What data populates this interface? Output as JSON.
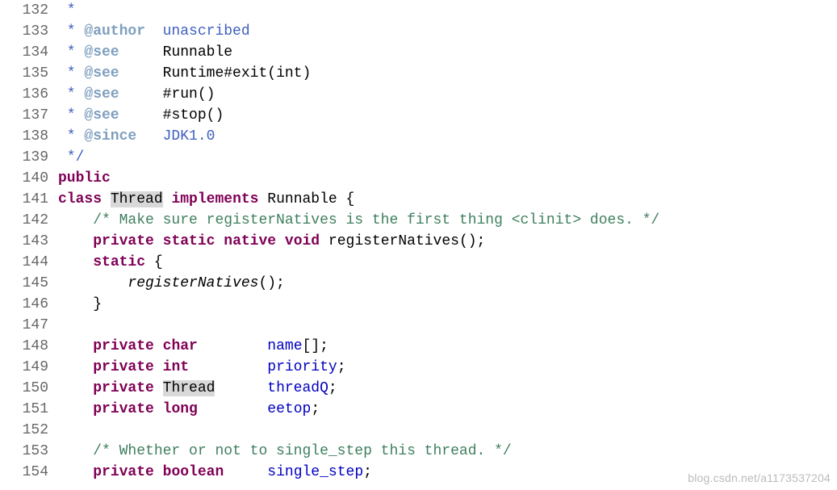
{
  "gutter": {
    "start": 132,
    "end": 154
  },
  "lines": {
    "132": {
      "segments": [
        {
          "cls": "jdoc-comment",
          "text": " *"
        }
      ]
    },
    "133": {
      "segments": [
        {
          "cls": "jdoc-comment",
          "text": " * "
        },
        {
          "cls": "jdoc-tag",
          "text": "@author"
        },
        {
          "cls": "jdoc-comment",
          "text": "  unascribed"
        }
      ]
    },
    "134": {
      "segments": [
        {
          "cls": "jdoc-comment",
          "text": " * "
        },
        {
          "cls": "jdoc-tag",
          "text": "@see"
        },
        {
          "cls": "jdoc-comment",
          "text": "     "
        },
        {
          "cls": "jdoc-code",
          "text": "Runnable"
        }
      ]
    },
    "135": {
      "segments": [
        {
          "cls": "jdoc-comment",
          "text": " * "
        },
        {
          "cls": "jdoc-tag",
          "text": "@see"
        },
        {
          "cls": "jdoc-comment",
          "text": "     "
        },
        {
          "cls": "jdoc-code",
          "text": "Runtime#exit(int)"
        }
      ]
    },
    "136": {
      "segments": [
        {
          "cls": "jdoc-comment",
          "text": " * "
        },
        {
          "cls": "jdoc-tag",
          "text": "@see"
        },
        {
          "cls": "jdoc-comment",
          "text": "     "
        },
        {
          "cls": "jdoc-code",
          "text": "#run()"
        }
      ]
    },
    "137": {
      "segments": [
        {
          "cls": "jdoc-comment",
          "text": " * "
        },
        {
          "cls": "jdoc-tag",
          "text": "@see"
        },
        {
          "cls": "jdoc-comment",
          "text": "     "
        },
        {
          "cls": "jdoc-code",
          "text": "#stop()"
        }
      ]
    },
    "138": {
      "segments": [
        {
          "cls": "jdoc-comment",
          "text": " * "
        },
        {
          "cls": "jdoc-tag",
          "text": "@since"
        },
        {
          "cls": "jdoc-comment",
          "text": "   JDK1.0"
        }
      ]
    },
    "139": {
      "segments": [
        {
          "cls": "jdoc-comment",
          "text": " */"
        }
      ]
    },
    "140": {
      "segments": [
        {
          "cls": "kw",
          "text": "public"
        }
      ]
    },
    "141": {
      "segments": [
        {
          "cls": "kw",
          "text": "class"
        },
        {
          "text": " "
        },
        {
          "cls": "hl",
          "text": "Thread"
        },
        {
          "text": " "
        },
        {
          "cls": "kw",
          "text": "implements"
        },
        {
          "text": " Runnable {"
        }
      ]
    },
    "142": {
      "segments": [
        {
          "text": "    "
        },
        {
          "cls": "comment",
          "text": "/* Make sure registerNatives is the first thing <clinit> does. */"
        }
      ]
    },
    "143": {
      "segments": [
        {
          "text": "    "
        },
        {
          "cls": "kw",
          "text": "private"
        },
        {
          "text": " "
        },
        {
          "cls": "kw",
          "text": "static"
        },
        {
          "text": " "
        },
        {
          "cls": "kw",
          "text": "native"
        },
        {
          "text": " "
        },
        {
          "cls": "kw",
          "text": "void"
        },
        {
          "text": " registerNatives();"
        }
      ]
    },
    "144": {
      "segments": [
        {
          "text": "    "
        },
        {
          "cls": "kw",
          "text": "static"
        },
        {
          "text": " {"
        }
      ]
    },
    "145": {
      "segments": [
        {
          "text": "        "
        },
        {
          "cls": "ital",
          "text": "registerNatives"
        },
        {
          "text": "();"
        }
      ]
    },
    "146": {
      "segments": [
        {
          "text": "    }"
        }
      ]
    },
    "147": {
      "segments": [
        {
          "text": ""
        }
      ]
    },
    "148": {
      "segments": [
        {
          "text": "    "
        },
        {
          "cls": "kw",
          "text": "private"
        },
        {
          "text": " "
        },
        {
          "cls": "kw",
          "text": "char"
        },
        {
          "text": "        "
        },
        {
          "cls": "ident",
          "text": "name"
        },
        {
          "text": "[];"
        }
      ]
    },
    "149": {
      "segments": [
        {
          "text": "    "
        },
        {
          "cls": "kw",
          "text": "private"
        },
        {
          "text": " "
        },
        {
          "cls": "kw",
          "text": "int"
        },
        {
          "text": "         "
        },
        {
          "cls": "ident",
          "text": "priority"
        },
        {
          "text": ";"
        }
      ]
    },
    "150": {
      "segments": [
        {
          "text": "    "
        },
        {
          "cls": "kw",
          "text": "private"
        },
        {
          "text": " "
        },
        {
          "cls": "hl",
          "text": "Thread"
        },
        {
          "text": "      "
        },
        {
          "cls": "ident",
          "text": "threadQ"
        },
        {
          "text": ";"
        }
      ]
    },
    "151": {
      "segments": [
        {
          "text": "    "
        },
        {
          "cls": "kw",
          "text": "private"
        },
        {
          "text": " "
        },
        {
          "cls": "kw",
          "text": "long"
        },
        {
          "text": "        "
        },
        {
          "cls": "ident",
          "text": "eetop"
        },
        {
          "text": ";"
        }
      ]
    },
    "152": {
      "segments": [
        {
          "text": ""
        }
      ]
    },
    "153": {
      "segments": [
        {
          "text": "    "
        },
        {
          "cls": "comment",
          "text": "/* Whether or not to single_step this thread. */"
        }
      ]
    },
    "154": {
      "segments": [
        {
          "text": "    "
        },
        {
          "cls": "kw",
          "text": "private"
        },
        {
          "text": " "
        },
        {
          "cls": "kw",
          "text": "boolean"
        },
        {
          "text": "     "
        },
        {
          "cls": "ident",
          "text": "single_step"
        },
        {
          "text": ";"
        }
      ]
    }
  },
  "watermark": "blog.csdn.net/a1173537204"
}
